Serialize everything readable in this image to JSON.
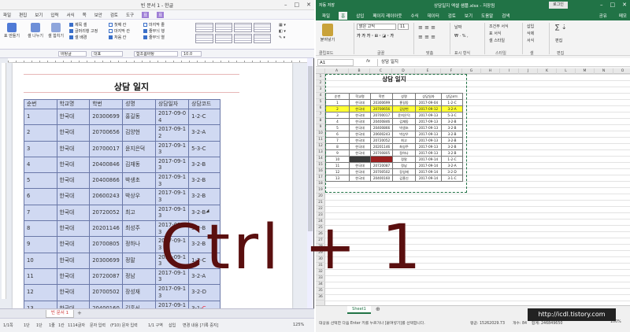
{
  "hwp": {
    "title": "빈 문서 1 - 한글",
    "menus": [
      "파일",
      "편집",
      "보기",
      "입력",
      "서식",
      "쪽",
      "보안",
      "검토",
      "도구",
      "표",
      "표"
    ],
    "ribbon": {
      "btn_new": "표 만들기",
      "btn_cell": "셀 나누기",
      "btn_merge": "셀 합치기",
      "checks1": [
        "제목 셀",
        "글머리행 고정",
        "셀 배경"
      ],
      "checks2": [
        "첫째 칸",
        "마지막 칸",
        "처음 칸"
      ],
      "checks3": [
        "마지막 줄",
        "줄무늬 행",
        "줄무늬 열"
      ]
    },
    "format": {
      "style": "바탕글",
      "font": "대표",
      "face": "함초롬바탕",
      "size": "10.0"
    },
    "doc_title": "상담 일지",
    "headers": [
      "순번",
      "학교명",
      "학번",
      "성명",
      "상담일자",
      "상담코드"
    ],
    "rows": [
      [
        "1",
        "한국대",
        "20300699",
        "홍길동",
        "2017-09-0",
        "4",
        "1-2-C"
      ],
      [
        "2",
        "한국대",
        "20700656",
        "김양현",
        "2017-09-1",
        "2",
        "3-2-A"
      ],
      [
        "3",
        "한국대",
        "20700017",
        "윤지은덕",
        "2017-09-1",
        "3",
        "5-3-C"
      ],
      [
        "4",
        "한국대",
        "20400846",
        "김재동",
        "2017-09-1",
        "3",
        "3-2-B"
      ],
      [
        "5",
        "한국대",
        "20400866",
        "박생초",
        "2017-09-1",
        "3",
        "3-2-B"
      ],
      [
        "6",
        "한국대",
        "20600243",
        "박상우",
        "2017-09-1",
        "3",
        "3-2-B"
      ],
      [
        "7",
        "한국대",
        "20720052",
        "최고",
        "2017-09-1",
        "3",
        "3-2-B"
      ],
      [
        "8",
        "한국대",
        "20201146",
        "최성주",
        "2017-09-1",
        "3",
        "3-2-B"
      ],
      [
        "9",
        "한국대",
        "20700805",
        "정하나",
        "2017-09-1",
        "3",
        "3-2-B"
      ],
      [
        "10",
        "한국대",
        "20300699",
        "정말",
        "2017-09-1",
        "3",
        "1-2-C"
      ],
      [
        "11",
        "한국대",
        "20720087",
        "정남",
        "2017-09-1",
        "3",
        "3-2-A"
      ],
      [
        "12",
        "한국대",
        "20700502",
        "장성재",
        "2017-09-1",
        "3",
        "3-2-D"
      ],
      [
        "13",
        "한국대",
        "20400160",
        "김홍신",
        "2017-09-1",
        "3",
        "3-1-"
      ]
    ],
    "last_suffix": "C",
    "tab_label": "빈 문서 1",
    "status": [
      "1/1쪽",
      "1단",
      "1단",
      "1줄",
      "1칸",
      "1114글자",
      "문자 입력",
      "(F10) 문자 입력",
      "1/1 구역",
      "삽입",
      "변경 내용 [기록 중지]",
      "125%"
    ]
  },
  "excel": {
    "autosave": "자동 저장",
    "title": "상담일지 엑셀 샘플.xlsx - 저장됨",
    "signin": "로그인",
    "tabs": [
      "파일",
      "홈",
      "삽입",
      "페이지 레이아웃",
      "수식",
      "데이터",
      "검토",
      "보기",
      "도움말",
      "검색"
    ],
    "share": "공유",
    "comment": "메모",
    "ribbon": {
      "paste": "붙여넣기",
      "font": "맑은 고딕",
      "size": "11",
      "groups": [
        "클립보드",
        "글꼴",
        "맞춤",
        "표시 형식",
        "스타일",
        "셀",
        "편집"
      ],
      "numfmt": "날짜",
      "style1": "조건부 서식",
      "style2": "표 서식",
      "style3": "셀 스타일",
      "cell1": "삽입",
      "cell2": "삭제",
      "cell3": "서식",
      "edit": "편집"
    },
    "namebox": "A1",
    "fx": "fx",
    "formula_value": "상담 일지",
    "columns": [
      "A",
      "B",
      "C",
      "D",
      "E",
      "F",
      "G",
      "H",
      "I",
      "J",
      "K",
      "L",
      "M",
      "N",
      "O",
      "P",
      "Q",
      "R",
      "S"
    ],
    "row_numbers": [
      "1",
      "2",
      "3",
      "4",
      "5",
      "6",
      "7",
      "8",
      "9",
      "10",
      "11",
      "12",
      "13",
      "14",
      "15",
      "16",
      "17",
      "18",
      "19",
      "20",
      "21",
      "22",
      "23",
      "24",
      "25",
      "26",
      "27",
      "28",
      "29",
      "30",
      "31",
      "32",
      "33",
      "34",
      "35",
      "36"
    ],
    "sheet_title": "상담 일지",
    "headers": [
      "순번",
      "학교명",
      "학번",
      "성명",
      "상담일자",
      "상담코드"
    ],
    "rows": [
      [
        "1",
        "한국대",
        "20300699",
        "홍길동",
        "2017-09-04",
        "1-2-C"
      ],
      [
        "2",
        "한국대",
        "20700656",
        "김양현",
        "2017-09-12",
        "3-2-A"
      ],
      [
        "3",
        "한국대",
        "20700017",
        "윤지은덕",
        "2017-09-13",
        "5-3-C"
      ],
      [
        "4",
        "한국대",
        "20400846",
        "김재동",
        "2017-09-13",
        "3-2-B"
      ],
      [
        "5",
        "한국대",
        "20400866",
        "박생초",
        "2017-09-13",
        "3-2-B"
      ],
      [
        "6",
        "한국대",
        "20600243",
        "박상우",
        "2017-09-13",
        "3-2-B"
      ],
      [
        "7",
        "한국대",
        "20720052",
        "최고",
        "2017-09-13",
        "3-2-B"
      ],
      [
        "8",
        "한국대",
        "20201146",
        "최성주",
        "2017-09-13",
        "3-2-B"
      ],
      [
        "9",
        "한국대",
        "20700805",
        "정하나",
        "2017-09-13",
        "3-2-B"
      ],
      [
        "10",
        "",
        "",
        "정말",
        "2017-09-14",
        "1-2-C"
      ],
      [
        "11",
        "한국대",
        "20720087",
        "정남",
        "2017-09-14",
        "3-2-A"
      ],
      [
        "12",
        "한국대",
        "20700502",
        "장성재",
        "2017-09-14",
        "3-2-D"
      ],
      [
        "13",
        "한국대",
        "20400160",
        "김홍신",
        "2017-09-14",
        "3-1-C"
      ]
    ],
    "sheet_tab": "Sheet1",
    "status_left": "대상을 선택한 다음 Enter 키를 누르거나 [붙여넣기]를 선택합니다.",
    "status_mid": "평균: 15262029.73",
    "status_count": "개수: 84",
    "status_sum": "합계: 246849650",
    "zoom": "100%"
  },
  "overlay": {
    "shortcut": "Ctrl  +  1"
  },
  "watermark": "http://icdl.tistory.com"
}
